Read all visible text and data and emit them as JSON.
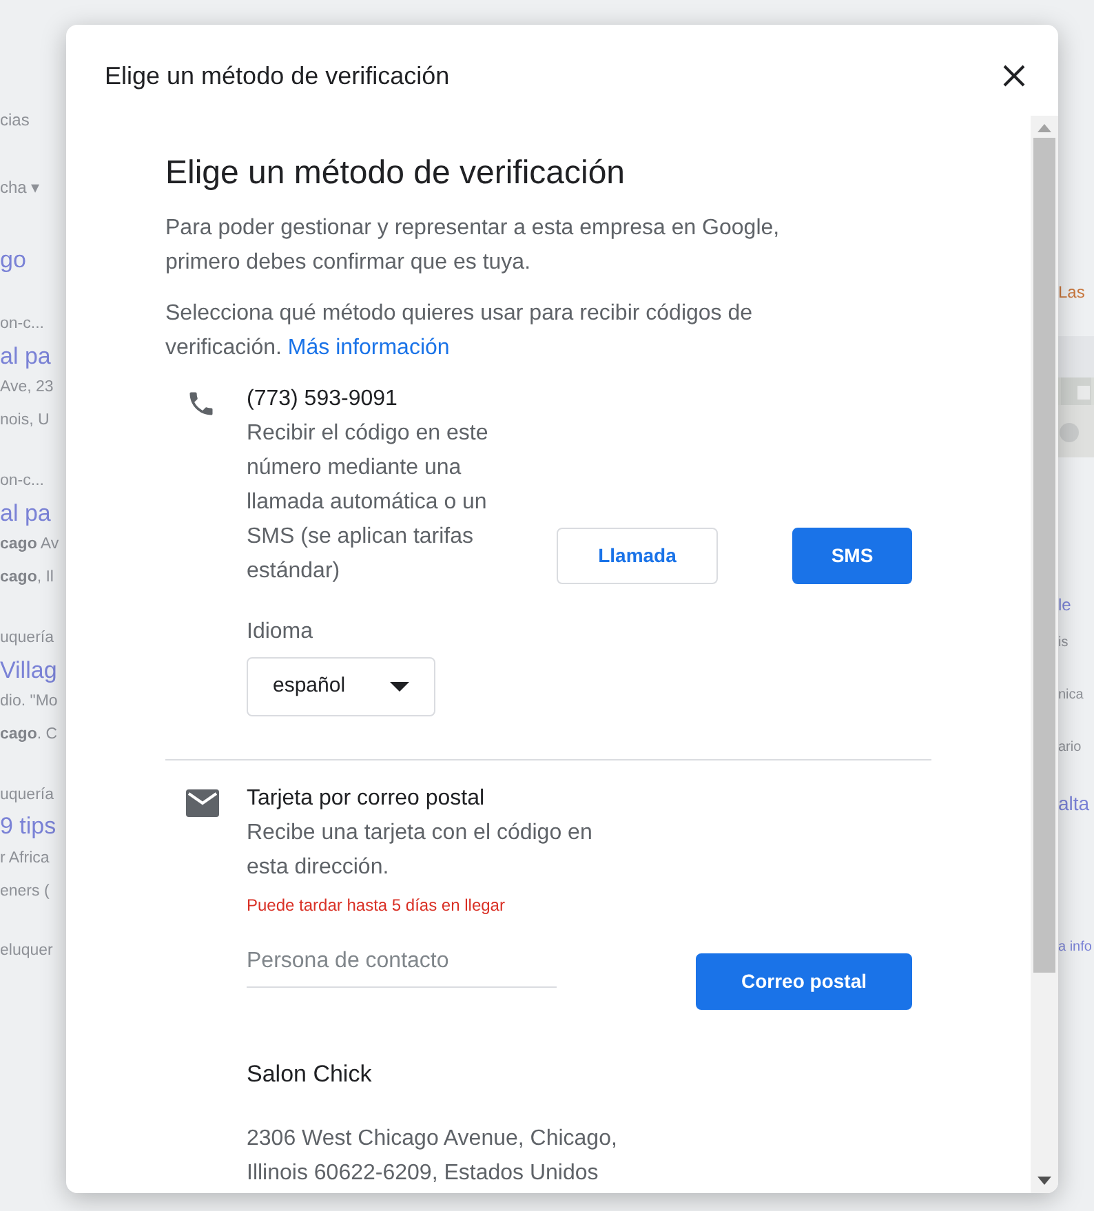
{
  "background_page": {
    "left_fragments": [
      {
        "kind": "label",
        "text": "cias"
      },
      {
        "kind": "label",
        "text": "cha ▾"
      },
      {
        "kind": "title",
        "text": "go"
      },
      {
        "kind": "category",
        "text": "on-c..."
      },
      {
        "kind": "title",
        "text": "al pa"
      },
      {
        "kind": "snippet",
        "text": "Ave, 23"
      },
      {
        "kind": "snippet",
        "text": "nois, U"
      },
      {
        "kind": "category",
        "text": "on-c..."
      },
      {
        "kind": "title",
        "text": "al pa"
      },
      {
        "kind": "snippet",
        "text": "**cago** Av"
      },
      {
        "kind": "snippet",
        "text": "**cago**, Il"
      },
      {
        "kind": "category",
        "text": "uquería"
      },
      {
        "kind": "title",
        "text": "Villag"
      },
      {
        "kind": "snippet",
        "text": "dio. \"Mo"
      },
      {
        "kind": "snippet",
        "text": "**cago**. C"
      },
      {
        "kind": "category",
        "text": "uquería"
      },
      {
        "kind": "title",
        "text": "9 tips"
      },
      {
        "kind": "snippet",
        "text": "r Africa"
      },
      {
        "kind": "snippet",
        "text": "eners ("
      },
      {
        "kind": "category",
        "text": "eluquer"
      }
    ],
    "right_fragments": [
      {
        "kind": "accent",
        "text": "Las"
      },
      {
        "kind": "picture"
      },
      {
        "kind": "link",
        "text": "le"
      },
      {
        "kind": "snippet",
        "text": "is"
      },
      {
        "kind": "snippet",
        "text": "nica"
      },
      {
        "kind": "snippet",
        "text": "ario"
      },
      {
        "kind": "title",
        "text": "alta"
      },
      {
        "kind": "link",
        "text": "a info"
      }
    ]
  },
  "dialog": {
    "title": "Elige un método de verificación",
    "heading": "Elige un método de verificación",
    "intro": "Para poder gestionar y representar a esta empresa en Google, primero debes confirmar que es tuya.",
    "instruction": "Selecciona qué método quieres usar para recibir códigos de verificación.",
    "more_info_link": "Más información",
    "methods": [
      {
        "kind": "phone",
        "title": "(773) 593-9091",
        "description": "Recibir el código en este número mediante una llamada automática o un SMS (se aplican tarifas estándar)",
        "language": {
          "label": "Idioma",
          "value": "español"
        },
        "buttons": [
          {
            "label": "Llamada",
            "kind": "outline"
          },
          {
            "label": "SMS",
            "kind": "primary"
          }
        ]
      },
      {
        "kind": "mail",
        "title": "Tarjeta por correo postal",
        "description": "Recibe una tarjeta con el código en esta dirección.",
        "note": "Puede tardar hasta 5 días en llegar",
        "field": {
          "placeholder": "Persona de contacto"
        },
        "buttons": [
          {
            "label": "Correo postal",
            "kind": "primary"
          }
        ],
        "business_name": "Salon Chick",
        "address": "2306 West Chicago Avenue, Chicago, Illinois 60622-6209, Estados Unidos"
      }
    ]
  }
}
